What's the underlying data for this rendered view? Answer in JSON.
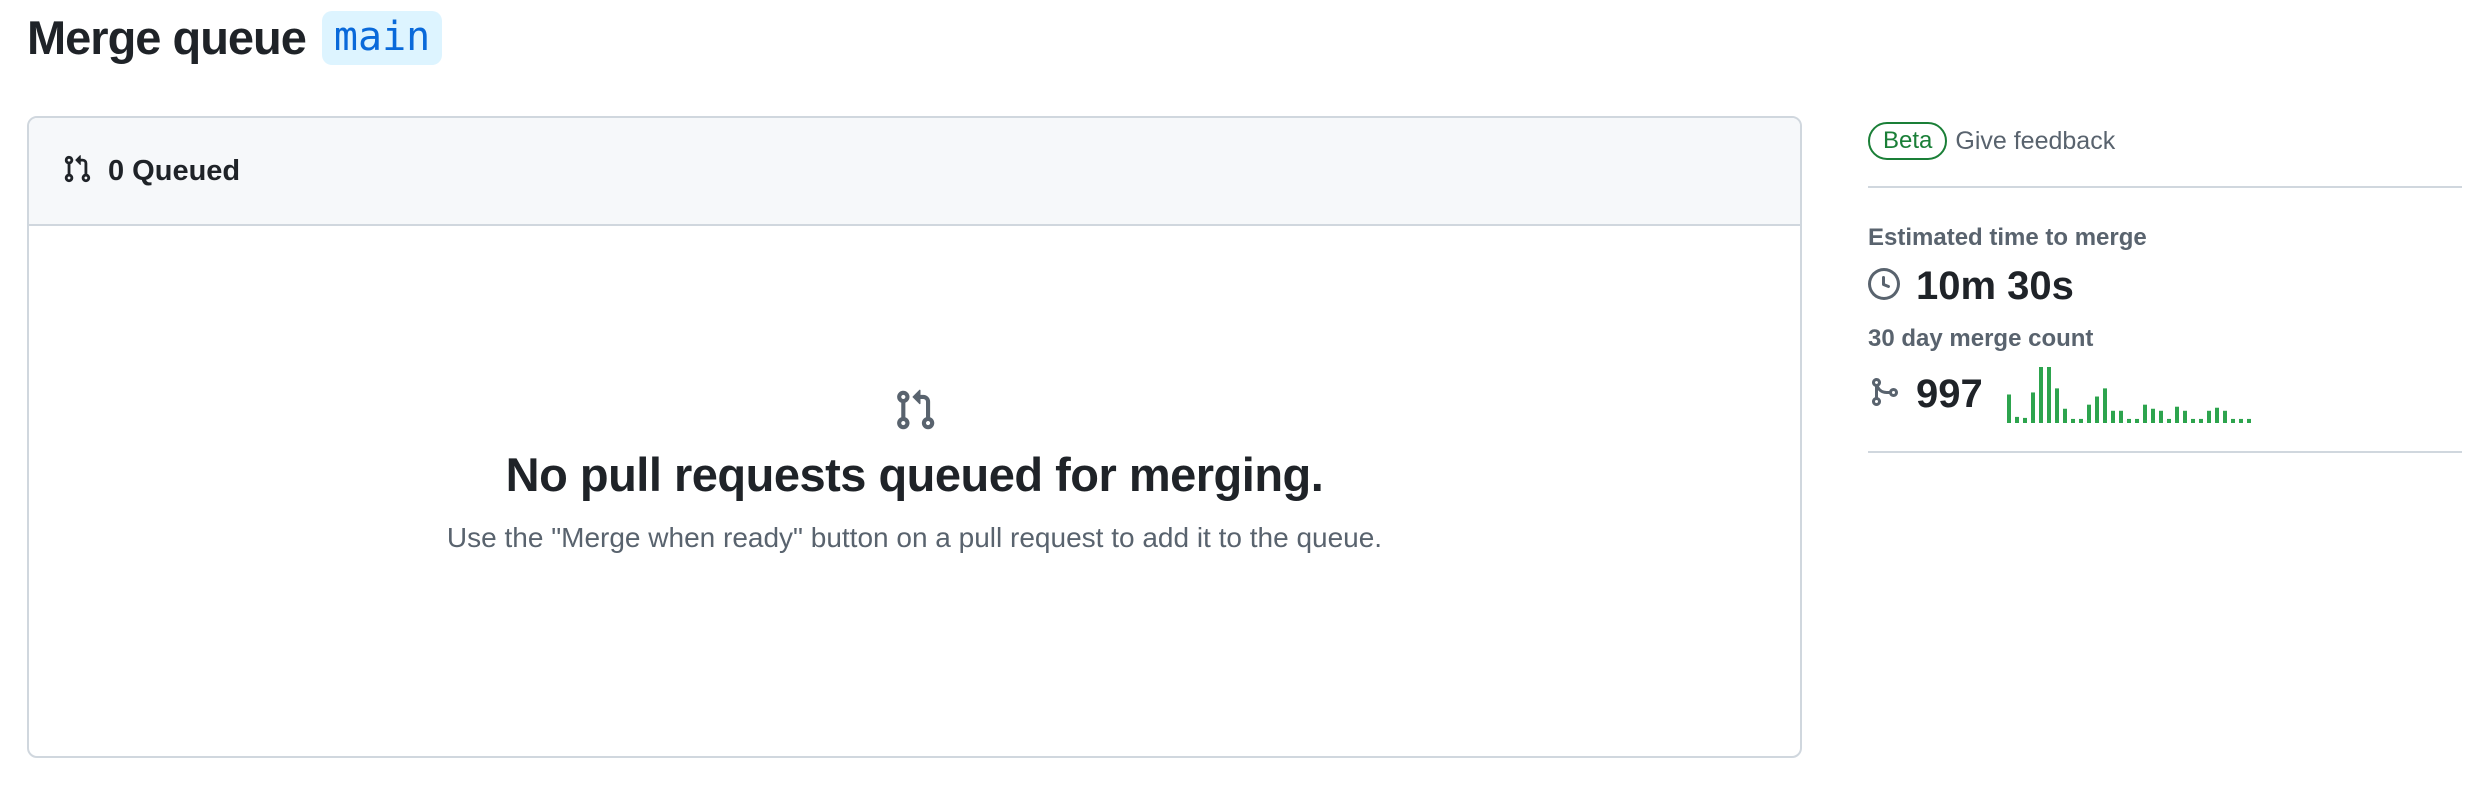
{
  "header": {
    "title": "Merge queue",
    "branch": "main"
  },
  "queue": {
    "count_label": "0 Queued",
    "icon": "git-pull-request-icon",
    "empty_icon": "git-pull-request-icon",
    "empty_title": "No pull requests queued for merging.",
    "empty_description": "Use the \"Merge when ready\" button on a pull request to add it to the queue."
  },
  "sidebar": {
    "beta_label": "Beta",
    "feedback_label": "Give feedback",
    "estimated_label": "Estimated time to merge",
    "estimated_value": "10m 30s",
    "estimated_icon": "clock-icon",
    "merge_count_label": "30 day merge count",
    "merge_count_value": "997",
    "merge_count_icon": "git-merge-icon",
    "sparkline_values": [
      28,
      6,
      5,
      30,
      55,
      55,
      34,
      14,
      4,
      4,
      18,
      26,
      34,
      12,
      12,
      4,
      4,
      18,
      14,
      12,
      4,
      16,
      12,
      4,
      4,
      12,
      15,
      12,
      4,
      4,
      4
    ],
    "sparkline_color": "#2da44e"
  },
  "colors": {
    "accent": "#0969da",
    "success": "#1a7f37",
    "border": "#d0d7de",
    "muted": "#59636e"
  }
}
